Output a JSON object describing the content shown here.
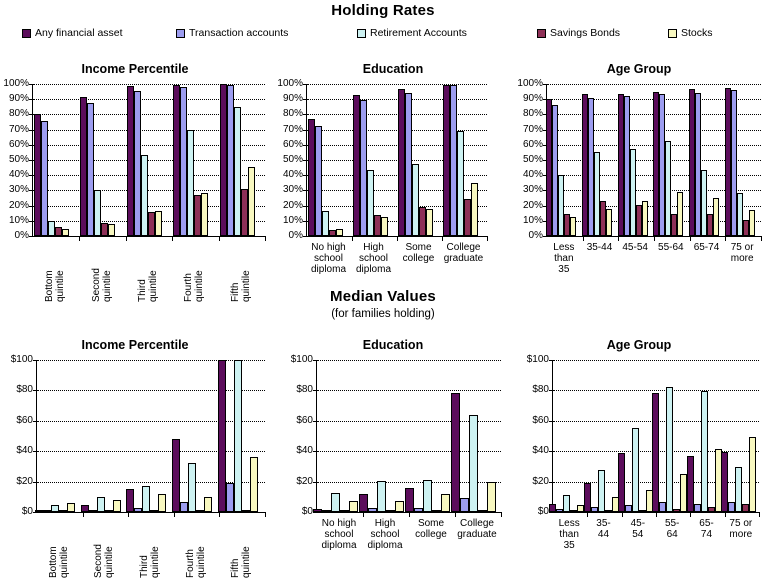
{
  "headings": {
    "top_title": "Holding Rates",
    "bottom_title": "Median Values",
    "bottom_subtitle": "(for families holding)"
  },
  "legend": {
    "items": [
      {
        "label": "Any financial asset",
        "color": "#5C0D5C"
      },
      {
        "label": "Transaction accounts",
        "color": "#9D9DF0"
      },
      {
        "label": "Retirement Accounts",
        "color": "#CDF2F2"
      },
      {
        "label": "Savings Bonds",
        "color": "#8E3057"
      },
      {
        "label": "Stocks",
        "color": "#F8F8C0"
      }
    ]
  },
  "chart_data": [
    {
      "id": "holding-income",
      "type": "bar",
      "title": "Income Percentile",
      "xlabel": "",
      "ylabel": "",
      "ylim": [
        0,
        100
      ],
      "ytick_labels": [
        "0%",
        "10%",
        "20%",
        "30%",
        "40%",
        "50%",
        "60%",
        "70%",
        "80%",
        "90%",
        "100%"
      ],
      "ytick_values": [
        0,
        10,
        20,
        30,
        40,
        50,
        60,
        70,
        80,
        90,
        100
      ],
      "grid": true,
      "legend_position": "top-shared",
      "categories": [
        "Bottom\nquintile",
        "Second\nquintile",
        "Third\nquintile",
        "Fourth\nquintile",
        "Fifth\nquintile"
      ],
      "series": [
        {
          "name": "Any financial asset",
          "values": [
            80.0,
            91.3,
            98.7,
            99.4,
            99.9
          ]
        },
        {
          "name": "Transaction accounts",
          "values": [
            75.6,
            87.5,
            95.7,
            98.3,
            99.4
          ]
        },
        {
          "name": "Retirement Accounts",
          "values": [
            9.8,
            30.0,
            53.0,
            70.0,
            85.0
          ]
        },
        {
          "name": "Savings Bonds",
          "values": [
            6.1,
            8.8,
            15.5,
            26.7,
            31.2
          ]
        },
        {
          "name": "Stocks",
          "values": [
            4.8,
            8.2,
            16.3,
            28.1,
            45.4
          ]
        }
      ]
    },
    {
      "id": "holding-education",
      "type": "bar",
      "title": "Education",
      "xlabel": "",
      "ylabel": "",
      "ylim": [
        0,
        100
      ],
      "ytick_labels": [
        "0%",
        "10%",
        "20%",
        "30%",
        "40%",
        "50%",
        "60%",
        "70%",
        "80%",
        "90%",
        "100%"
      ],
      "ytick_values": [
        0,
        10,
        20,
        30,
        40,
        50,
        60,
        70,
        80,
        90,
        100
      ],
      "grid": true,
      "categories": [
        "No high\nschool\ndiploma",
        "High\nschool\ndiploma",
        "Some\ncollege",
        "College\ngraduate"
      ],
      "series": [
        {
          "name": "Any financial asset",
          "values": [
            77.3,
            92.6,
            96.5,
            99.3
          ]
        },
        {
          "name": "Transaction accounts",
          "values": [
            72.4,
            89.2,
            94.1,
            99.2
          ]
        },
        {
          "name": "Retirement Accounts",
          "values": [
            16.3,
            43.3,
            47.7,
            69.1
          ]
        },
        {
          "name": "Savings Bonds",
          "values": [
            3.8,
            14.0,
            19.2,
            24.3
          ]
        },
        {
          "name": "Stocks",
          "values": [
            4.9,
            12.8,
            17.6,
            35.0
          ]
        }
      ]
    },
    {
      "id": "holding-age",
      "type": "bar",
      "title": "Age Group",
      "xlabel": "",
      "ylabel": "",
      "ylim": [
        0,
        100
      ],
      "ytick_labels": [
        "0%",
        "10%",
        "20%",
        "30%",
        "40%",
        "50%",
        "60%",
        "70%",
        "80%",
        "90%",
        "100%"
      ],
      "ytick_values": [
        0,
        10,
        20,
        30,
        40,
        50,
        60,
        70,
        80,
        90,
        100
      ],
      "grid": true,
      "categories": [
        "Less\nthan\n35",
        "35-44",
        "45-54",
        "55-64",
        "65-74",
        "75 or\nmore"
      ],
      "series": [
        {
          "name": "Any financial asset",
          "values": [
            90.0,
            93.5,
            93.5,
            95.0,
            96.5,
            97.3
          ]
        },
        {
          "name": "Transaction accounts",
          "values": [
            86.5,
            90.8,
            92.2,
            93.6,
            94.4,
            96.3
          ]
        },
        {
          "name": "Retirement Accounts",
          "values": [
            40.0,
            55.6,
            57.5,
            62.8,
            43.4,
            28.6
          ]
        },
        {
          "name": "Savings Bonds",
          "values": [
            14.8,
            23.1,
            20.6,
            14.8,
            14.6,
            10.4
          ]
        },
        {
          "name": "Stocks",
          "values": [
            12.7,
            18.0,
            22.8,
            29.0,
            25.2,
            17.2
          ]
        }
      ]
    },
    {
      "id": "median-income",
      "type": "bar",
      "title": "Income Percentile",
      "xlabel": "",
      "ylabel": "",
      "ylim": [
        0,
        100
      ],
      "ytick_labels": [
        "$0",
        "$20",
        "$40",
        "$60",
        "$80",
        "$100"
      ],
      "ytick_values": [
        0,
        20,
        40,
        60,
        80,
        100
      ],
      "grid": true,
      "categories": [
        "Bottom\nquintile",
        "Second\nquintile",
        "Third\nquintile",
        "Fourth\nquintile",
        "Fifth\nquintile"
      ],
      "series": [
        {
          "name": "Any financial asset",
          "values": [
            1.3,
            4.7,
            15.3,
            48.2,
            101.5
          ]
        },
        {
          "name": "Transaction accounts",
          "values": [
            0.6,
            1.2,
            2.5,
            6.5,
            19.3
          ]
        },
        {
          "name": "Retirement Accounts",
          "values": [
            4.5,
            10.0,
            17.3,
            32.0,
            102.0
          ]
        },
        {
          "name": "Savings Bonds",
          "values": [
            0.3,
            0.5,
            0.7,
            0.8,
            1.3
          ]
        },
        {
          "name": "Stocks",
          "values": [
            5.7,
            8.0,
            12.0,
            10.0,
            36.0
          ]
        }
      ]
    },
    {
      "id": "median-education",
      "type": "bar",
      "title": "Education",
      "xlabel": "",
      "ylabel": "",
      "ylim": [
        0,
        100
      ],
      "ytick_labels": [
        "$0",
        "$20",
        "$40",
        "$60",
        "$80",
        "$100"
      ],
      "ytick_values": [
        0,
        20,
        40,
        60,
        80,
        100
      ],
      "grid": true,
      "categories": [
        "No high\nschool\ndiploma",
        "High\nschool\ndiploma",
        "Some\ncollege",
        "College\ngraduate"
      ],
      "series": [
        {
          "name": "Any financial asset",
          "values": [
            2.2,
            11.8,
            16.0,
            78.0
          ]
        },
        {
          "name": "Transaction accounts",
          "values": [
            1.2,
            2.5,
            2.5,
            9.2
          ]
        },
        {
          "name": "Retirement Accounts",
          "values": [
            12.5,
            20.5,
            21.2,
            64.0
          ]
        },
        {
          "name": "Savings Bonds",
          "values": [
            0.6,
            0.8,
            0.8,
            1.3
          ]
        },
        {
          "name": "Stocks",
          "values": [
            7.2,
            7.2,
            12.0,
            19.8
          ]
        }
      ]
    },
    {
      "id": "median-age",
      "type": "bar",
      "title": "Age Group",
      "xlabel": "",
      "ylabel": "",
      "ylim": [
        0,
        100
      ],
      "ytick_labels": [
        "$0",
        "$20",
        "$40",
        "$60",
        "$80",
        "$100"
      ],
      "ytick_values": [
        0,
        20,
        40,
        60,
        80,
        100
      ],
      "grid": true,
      "categories": [
        "Less\nthan\n35",
        "35-\n44",
        "45-\n54",
        "55-\n64",
        "65-\n74",
        "75 or\nmore"
      ],
      "series": [
        {
          "name": "Any financial asset",
          "values": [
            5.2,
            19.4,
            38.6,
            78.0,
            36.8,
            39.3
          ]
        },
        {
          "name": "Transaction accounts",
          "values": [
            2.0,
            3.3,
            4.6,
            6.5,
            5.2,
            6.6
          ]
        },
        {
          "name": "Retirement Accounts",
          "values": [
            11.2,
            27.8,
            55.2,
            82.5,
            79.8,
            29.8
          ]
        },
        {
          "name": "Savings Bonds",
          "values": [
            0.6,
            0.7,
            1.1,
            2.2,
            3.2,
            5.2
          ]
        },
        {
          "name": "Stocks",
          "values": [
            4.6,
            10.0,
            14.7,
            25.2,
            41.6,
            49.5
          ]
        }
      ]
    }
  ]
}
